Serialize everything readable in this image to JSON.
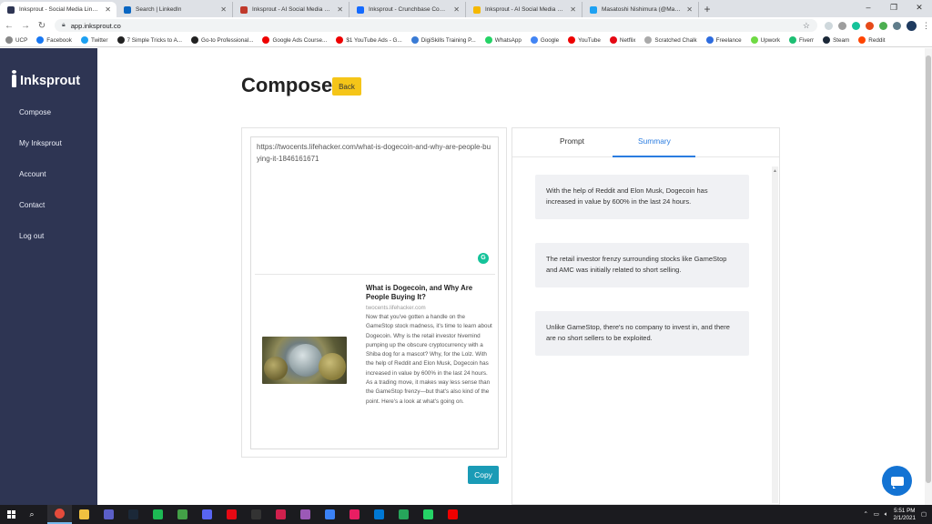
{
  "browser": {
    "tabs": [
      {
        "title": "Inksprout - Social Media Link Sh",
        "color": "#2e3553",
        "active": true
      },
      {
        "title": "Search | LinkedIn",
        "color": "#0a66c2"
      },
      {
        "title": "Inksprout - AI Social Media Write",
        "color": "#c0392b"
      },
      {
        "title": "Inksprout - Crunchbase Company",
        "color": "#146aff"
      },
      {
        "title": "Inksprout - AI Social Media Sum",
        "color": "#f5b800"
      },
      {
        "title": "Masatoshi Nishimura (@Masato",
        "color": "#1da1f2"
      }
    ],
    "url": "app.inksprout.co",
    "bookmarks": [
      {
        "label": "UCP",
        "color": "#888"
      },
      {
        "label": "Facebook",
        "color": "#1877f2"
      },
      {
        "label": "Twitter",
        "color": "#1da1f2"
      },
      {
        "label": "7 Simple Tricks to A...",
        "color": "#222"
      },
      {
        "label": "Go-to Professional...",
        "color": "#222"
      },
      {
        "label": "Google Ads Course...",
        "color": "#e00"
      },
      {
        "label": "$1 YouTube Ads - G...",
        "color": "#e00"
      },
      {
        "label": "DigiSkills Training P...",
        "color": "#3a7bd5"
      },
      {
        "label": "WhatsApp",
        "color": "#25d366"
      },
      {
        "label": "Google",
        "color": "#4285f4"
      },
      {
        "label": "YouTube",
        "color": "#e00"
      },
      {
        "label": "Netflix",
        "color": "#e50914"
      },
      {
        "label": "Scratched Chalk",
        "color": "#aaa"
      },
      {
        "label": "Freelance",
        "color": "#2d6cdf"
      },
      {
        "label": "Upwork",
        "color": "#6fda44"
      },
      {
        "label": "Fiverr",
        "color": "#1dbf73"
      },
      {
        "label": "Steam",
        "color": "#1b2838"
      },
      {
        "label": "Reddit",
        "color": "#ff4500"
      }
    ]
  },
  "sidebar": {
    "brand": "Inksprout",
    "items": [
      {
        "label": "Compose"
      },
      {
        "label": "My Inksprout"
      },
      {
        "label": "Account"
      },
      {
        "label": "Contact"
      },
      {
        "label": "Log out"
      }
    ]
  },
  "main": {
    "title": "Compose",
    "back_label": "Back",
    "copy_label": "Copy",
    "editor": {
      "url_text": "https://twocents.lifehacker.com/what-is-dogecoin-and-why-are-people-buying-it-1846161671"
    },
    "preview": {
      "title": "What is Dogecoin, and Why Are People Buying It?",
      "domain": "twocents.lifehacker.com",
      "description": "Now that you've gotten a handle on the GameStop stock madness, it's time to learn about Dogecoin. Why is the retail investor hivemind pumping up the obscure cryptocurrency with a Shiba dog for a mascot? Why, for the Lolz. With the help of Reddit and Elon Musk, Dogecoin has increased in value by 600% in the last 24 hours. As a trading move, it makes way less sense than the GameStop frenzy—but that's also kind of the point. Here's a look at what's going on."
    },
    "tabs": {
      "prompt": "Prompt",
      "summary": "Summary"
    },
    "summaries": [
      "With the help of Reddit and Elon Musk, Dogecoin has increased in value by 600% in the last 24 hours.",
      "The retail investor frenzy surrounding stocks like GameStop and AMC was initially related to short selling.",
      "Unlike GameStop, there's no company to invest in, and there are no short sellers to be exploited."
    ]
  },
  "taskbar": {
    "time": "5:51 PM",
    "date": "2/1/2021",
    "app_colors": [
      "#e44b3b",
      "#f0c040",
      "#5b5fc7",
      "#1b2838",
      "#1db954",
      "#43a047",
      "#5865f2",
      "#e50914",
      "#333",
      "#d0204d",
      "#9b59b6",
      "#3b82f6",
      "#e91e63",
      "#0078d4",
      "#26a65b",
      "#25d366",
      "#e00"
    ]
  },
  "colors": {
    "sidebar_bg": "#2e3553",
    "accent_blue": "#2a7ce0",
    "back_button": "#f5c518",
    "copy_button": "#1a9bb6",
    "chat_button": "#1373d3"
  }
}
